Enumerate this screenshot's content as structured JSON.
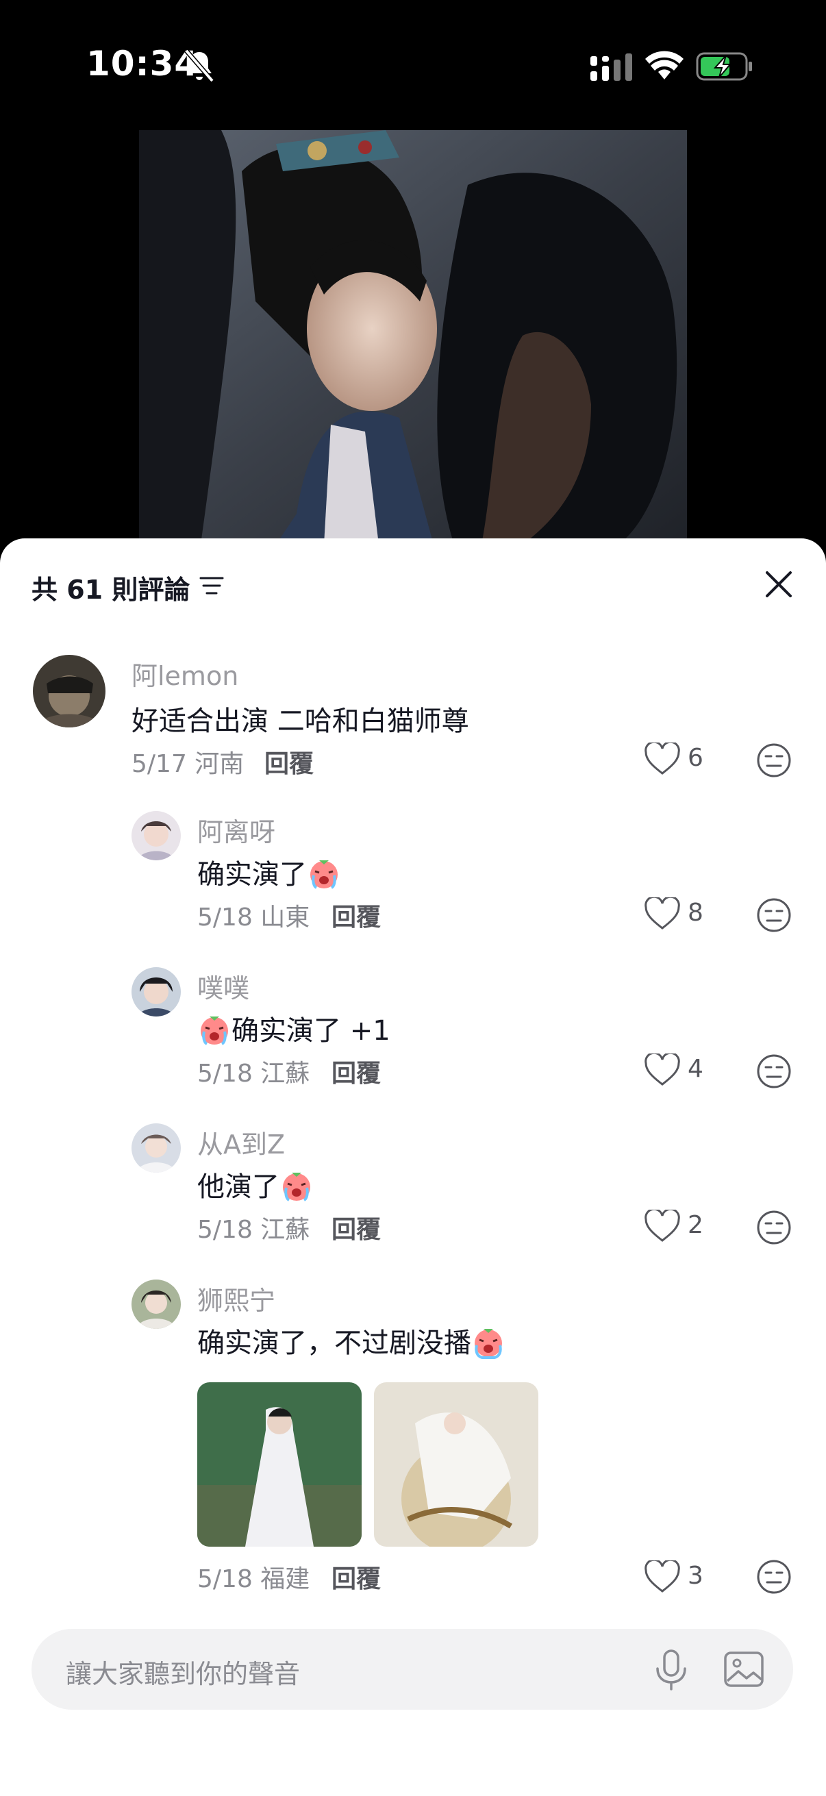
{
  "status_bar": {
    "time": "10:34"
  },
  "sheet": {
    "title": "共 61 則評論"
  },
  "comments": [
    {
      "user": "阿lemon",
      "text": "好适合出演  二哈和白猫师尊",
      "date_loc": "5/17 河南",
      "reply": "回覆",
      "likes": "6"
    },
    {
      "user": "阿离呀",
      "text": "确实演了",
      "date_loc": "5/18 山東",
      "reply": "回覆",
      "likes": "8"
    },
    {
      "user": "噗噗",
      "text": "确实演了 +1",
      "date_loc": "5/18 江蘇",
      "reply": "回覆",
      "likes": "4"
    },
    {
      "user": "从A到Z",
      "text": "他演了",
      "date_loc": "5/18 江蘇",
      "reply": "回覆",
      "likes": "2"
    },
    {
      "user": "狮熙宁",
      "text": "确实演了，不过剧没播",
      "date_loc": "5/18 福建",
      "reply": "回覆",
      "likes": "3"
    }
  ],
  "input": {
    "placeholder": "讓大家聽到你的聲音"
  },
  "colors": {
    "battery": "#34c759",
    "sheet_bg": "#ffffff",
    "text_primary": "#161823",
    "text_secondary": "#8a8b91"
  }
}
